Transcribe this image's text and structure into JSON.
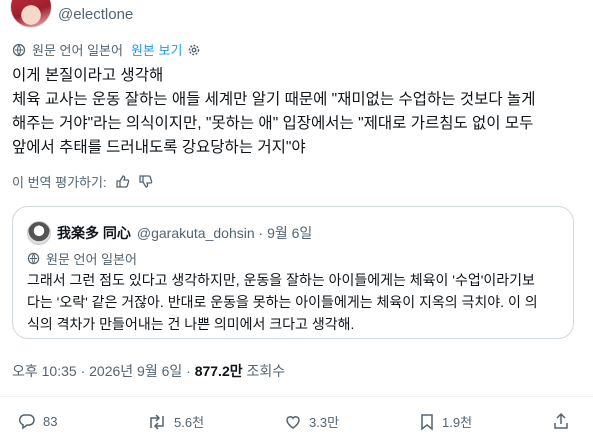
{
  "author": {
    "handle": "@electlone"
  },
  "translation": {
    "label": "원문 언어 일본어",
    "show_original": "원본 보기"
  },
  "tweet": {
    "lines": [
      "이게 본질이라고 생각해",
      "체육 교사는 운동 잘하는 애들 세계만 알기 때문에 \"재미없는 수업하는 것보다 놀게",
      "해주는 거야\"라는 의식이지만, \"못하는 애\" 입장에서는 \"제대로 가르침도 없이 모두",
      "앞에서 추태를 드러내도록 강요당하는 거지\"야"
    ]
  },
  "rate": {
    "label": "이 번역 평가하기:"
  },
  "quote": {
    "name": "我楽多 同心",
    "meta": "@garakuta_dohsin · 9월 6일",
    "translation_label": "원문 언어 일본어",
    "lines": [
      "그래서 그런 점도 있다고 생각하지만, 운동을 잘하는 아이들에게는 체육이 '수업'이라기보",
      "다는 '오락' 같은 거잖아. 반대로 운동을 못하는 아이들에게는 체육이 지옥의 극치야. 이 의",
      "식의 격차가 만들어내는 건 나쁜 의미에서 크다고 생각해."
    ]
  },
  "timestamp": {
    "time": "오후 10:35 · 2026년 9월 6일 · ",
    "views": "877.2만",
    "views_label": " 조회수"
  },
  "actions": {
    "replies": "83",
    "reposts": "5.6천",
    "likes": "3.3만",
    "bookmarks": "1.9천"
  }
}
